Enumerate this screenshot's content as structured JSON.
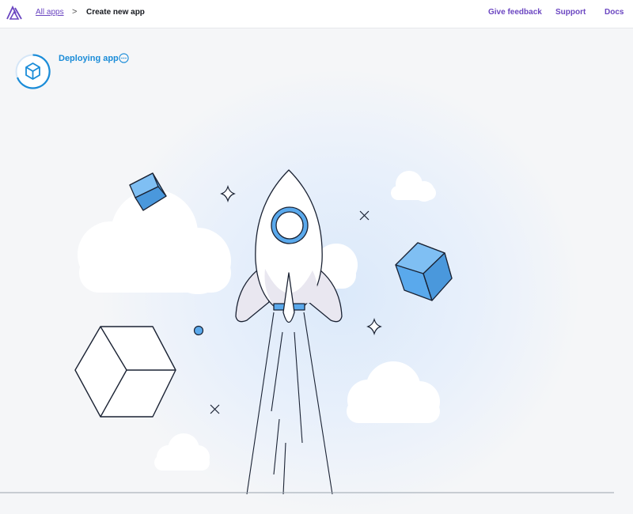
{
  "breadcrumb": {
    "all_apps": "All apps",
    "separator": ">",
    "current": "Create new app"
  },
  "nav": {
    "feedback": "Give feedback",
    "support": "Support",
    "docs": "Docs"
  },
  "status": {
    "text": "Deploying app",
    "icon": "cube-icon",
    "more_icon": "ellipsis-circle-icon"
  },
  "colors": {
    "accent": "#6b46c1",
    "status_blue": "#1a8cd8",
    "cube_blue": "#5aa9ec"
  }
}
